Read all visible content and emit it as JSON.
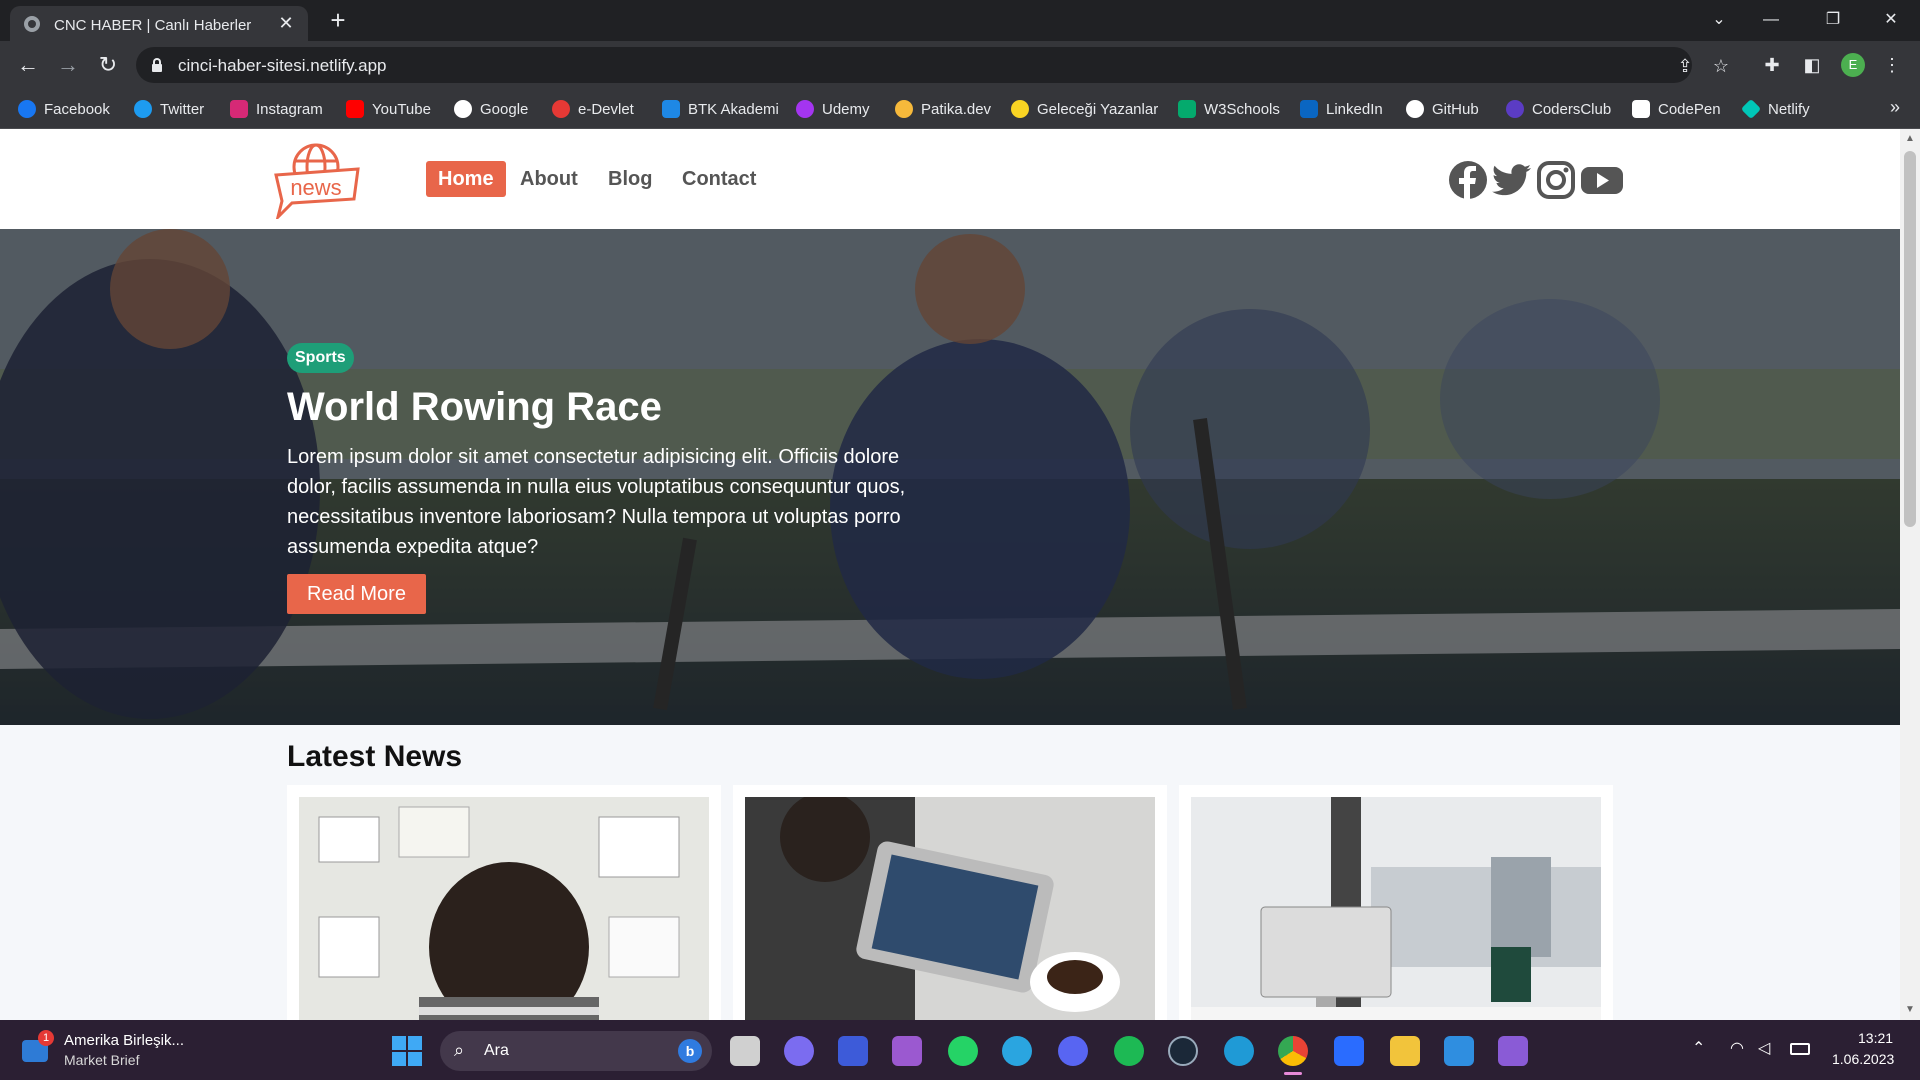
{
  "browser": {
    "tab_title": "CNC HABER | Canlı Haberler",
    "tab_close": "✕",
    "new_tab": "+",
    "url": "cinci-haber-sitesi.netlify.app",
    "profile_initial": "E",
    "window_controls": {
      "menu": "⌄",
      "minimize": "—",
      "restore": "❐",
      "close": "✕"
    }
  },
  "bookmarks": [
    {
      "label": "Facebook",
      "color": "#1877f2"
    },
    {
      "label": "Twitter",
      "color": "#1d9bf0"
    },
    {
      "label": "Instagram",
      "color": "#d62976"
    },
    {
      "label": "YouTube",
      "color": "#ff0000"
    },
    {
      "label": "Google",
      "color": "#ffffff"
    },
    {
      "label": "e-Devlet",
      "color": "#e53935"
    },
    {
      "label": "BTK Akademi",
      "color": "#1e88e5"
    },
    {
      "label": "Udemy",
      "color": "#a435f0"
    },
    {
      "label": "Patika.dev",
      "color": "#f6b93b"
    },
    {
      "label": "Geleceği Yazanlar",
      "color": "#f9d423"
    },
    {
      "label": "W3Schools",
      "color": "#04aa6d"
    },
    {
      "label": "LinkedIn",
      "color": "#0a66c2"
    },
    {
      "label": "GitHub",
      "color": "#ffffff"
    },
    {
      "label": "CodersClub",
      "color": "#5b3cc4"
    },
    {
      "label": "CodePen",
      "color": "#ffffff"
    },
    {
      "label": "Netlify",
      "color": "#00c7b7"
    }
  ],
  "site": {
    "logo_text": "news",
    "nav": [
      "Home",
      "About",
      "Blog",
      "Contact"
    ],
    "social_icons": [
      "facebook-icon",
      "twitter-icon",
      "instagram-icon",
      "youtube-icon"
    ],
    "hero": {
      "tag": "Sports",
      "title": "World Rowing Race",
      "text": "Lorem ipsum dolor sit amet consectetur adipisicing elit. Officiis dolore dolor, facilis assumenda in nulla eius voluptatibus consequuntur quos, necessitatibus inventore laboriosam? Nulla tempora ut voluptas porro assumenda expedita atque?",
      "button": "Read More"
    },
    "latest_title": "Latest News",
    "accent": "#e8664a",
    "tag_color": "#1e9e78"
  },
  "taskbar": {
    "widget_title": "Amerika Birleşik...",
    "widget_sub": "Market Brief",
    "widget_badge": "1",
    "search_placeholder": "Ara",
    "time": "13:21",
    "date": "1.06.2023"
  }
}
